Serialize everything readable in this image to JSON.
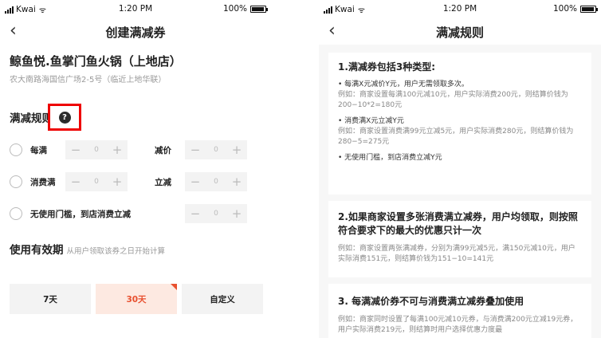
{
  "status_bar": {
    "carrier": "Kwai",
    "time": "1:20 PM",
    "battery": "100%",
    "battery_level": 0.95
  },
  "left_screen": {
    "title": "创建满减券",
    "store": {
      "name": "鲸鱼悦.鱼掌门鱼火锅（上地店）",
      "address": "农大南路海国信广场2-5号（临近上地华联）"
    },
    "rules_label": "满减规则",
    "rules": [
      {
        "label": "每满",
        "stepper1": "0",
        "mid_label": "减价",
        "stepper2": "0"
      },
      {
        "label": "消费满",
        "stepper1": "0",
        "mid_label": "立减",
        "stepper2": "0"
      },
      {
        "label": "无使用门槛，到店消费立减",
        "stepper2": "0"
      }
    ],
    "stepper_minus": "−",
    "stepper_plus": "+",
    "validity_label": "使用有效期",
    "validity_hint": "从用户领取该券之日开始计算",
    "validity_options": [
      "7天",
      "30天",
      "自定义"
    ],
    "validity_selected": "30天"
  },
  "right_screen": {
    "title": "满减规则",
    "section1": {
      "heading": "1.满减券包括3种类型:",
      "items": [
        {
          "bullet": "• 每满X元减价Y元，用户无需领取多次。",
          "example": "例如：商家设置每满100元减10元，用户实际消费200元，则结算价钱为200−10*2=180元"
        },
        {
          "bullet": "• 消费满X元立减Y元",
          "example": "例如：商家设置消费满99元立减5元，用户实际消费280元，则结算价钱为280−5=275元"
        },
        {
          "bullet": "• 无使用门槛，到店消费立减Y元",
          "example": ""
        }
      ]
    },
    "section2": {
      "heading": "2.如果商家设置多张消费满立减券，用户均领取，则按照符合要求下的最大的优惠只计一次",
      "example": "例如：商家设置两张满减券，分别为满99元减5元，满150元减10元，用户实际消费151元，则结算价钱为151−10=141元"
    },
    "section3": {
      "heading": "3. 每满减价券不可与消费满立减券叠加使用",
      "example": "例如：商家同时设置了每满100元减10元券，与消费满200元立减19元券，用户实际消费219元，则结算时用户选择优惠力度最"
    }
  },
  "colors": {
    "accent": "#e8502f",
    "highlight_box": "#ee0000"
  }
}
